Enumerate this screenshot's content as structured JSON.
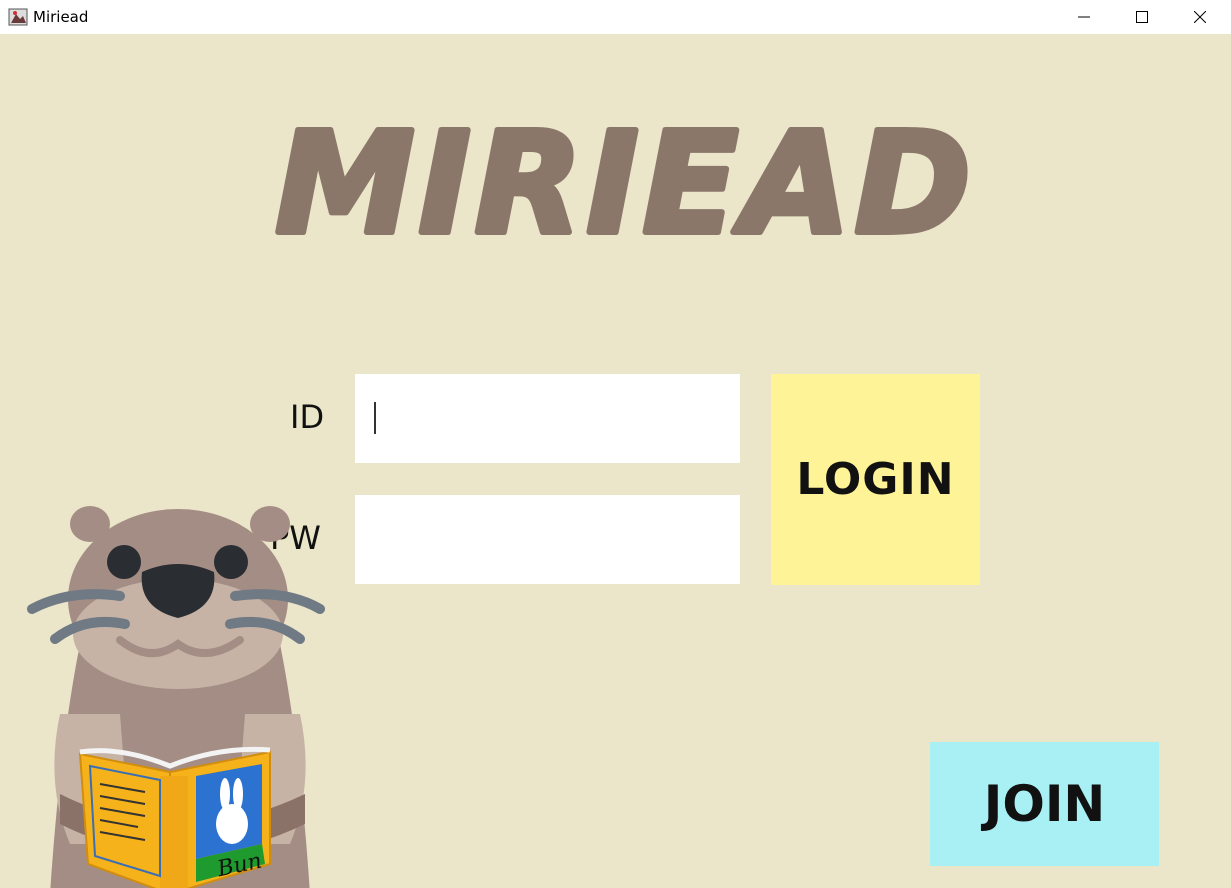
{
  "window": {
    "title": "Miriead",
    "icon": "app-icon",
    "controls": [
      "minimize-icon",
      "maximize-icon",
      "close-icon"
    ]
  },
  "logo": {
    "text": "MIRIEAD",
    "color": "#8b776a"
  },
  "form": {
    "id_label": "ID",
    "id_value": "",
    "pw_label": "PW",
    "pw_value": ""
  },
  "buttons": {
    "login_label": "LOGIN",
    "login_color": "#fff398",
    "join_label": "JOIN",
    "join_color": "#a8f0f4"
  },
  "mascot": {
    "book_text": "Bun"
  },
  "colors": {
    "background": "#ebe5c9"
  }
}
